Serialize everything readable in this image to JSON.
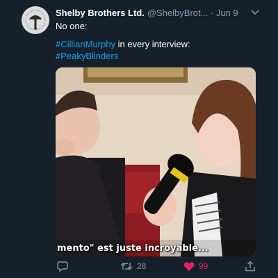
{
  "user": {
    "display_name": "Shelby Brothers Ltd.",
    "handle": "@ShelbyBrot...",
    "separator": "·",
    "date": "Jun 9",
    "avatar_icon": "peaky-cap-logo-icon"
  },
  "tweet": {
    "line1": "No one:",
    "hashtag1": "#CillianMurphy",
    "line2_rest": " in every interview:",
    "hashtag2": "#PeakyBlinders"
  },
  "media": {
    "subtitle": "mento\" est juste incroyable..."
  },
  "actions": {
    "reply_icon": "reply-icon",
    "retweet_icon": "retweet-icon",
    "retweet_count": "28",
    "like_icon": "heart-icon",
    "like_count": "99",
    "share_icon": "share-icon"
  },
  "colors": {
    "background": "#15202b",
    "link": "#1da1f2",
    "secondary": "#8899a6",
    "like": "#e0245e"
  }
}
